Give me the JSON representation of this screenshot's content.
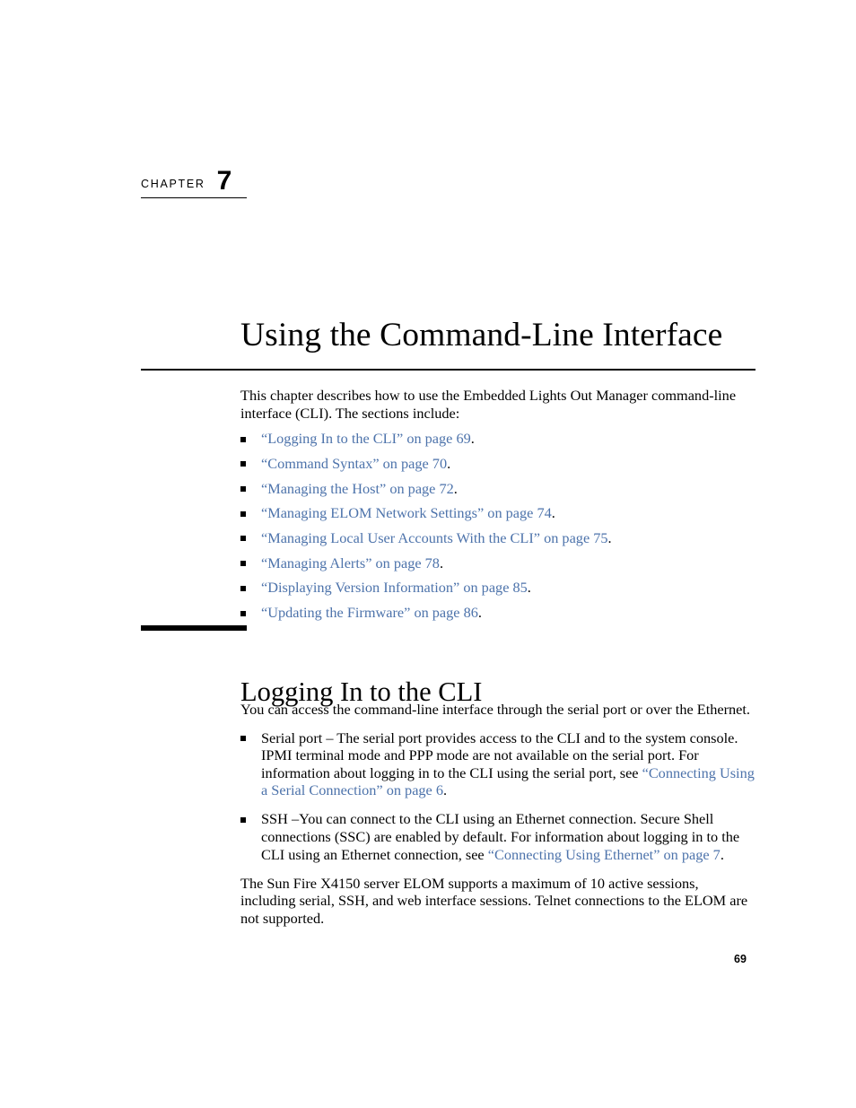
{
  "chapter": {
    "label": "CHAPTER",
    "number": "7",
    "title": "Using the Command-Line Interface"
  },
  "intro": {
    "paragraph": "This chapter describes how to use the Embedded Lights Out Manager command-line interface (CLI). The sections include:"
  },
  "toc": {
    "items": [
      {
        "link": "“Logging In to the CLI” on page 69",
        "trailing": "."
      },
      {
        "link": "“Command Syntax” on page 70",
        "trailing": "."
      },
      {
        "link": "“Managing the Host” on page 72",
        "trailing": "."
      },
      {
        "link": "“Managing ELOM Network Settings” on page 74",
        "trailing": "."
      },
      {
        "link": "“Managing Local User Accounts With the CLI” on page 75",
        "trailing": "."
      },
      {
        "link": "“Managing Alerts” on page 78",
        "trailing": "."
      },
      {
        "link": "“Displaying Version Information” on page 85",
        "trailing": "."
      },
      {
        "link": "“Updating the Firmware” on page 86",
        "trailing": "."
      }
    ]
  },
  "section": {
    "heading": "Logging In to the CLI",
    "intro": "You can access the command-line interface through the serial port or over the Ethernet.",
    "bullets": [
      {
        "text_before": "Serial port – The serial port provides access to the CLI and to the system console. IPMI terminal mode and PPP mode are not available on the serial port. For information about logging in to the CLI using the serial port, see ",
        "link": "“Connecting Using a Serial Connection” on page 6",
        "text_after": "."
      },
      {
        "text_before": "SSH –You can connect to the CLI using an Ethernet connection. Secure Shell connections (SSC) are enabled by default. For information about logging in to the CLI using an Ethernet connection, see ",
        "link": "“Connecting Using Ethernet” on page 7",
        "text_after": "."
      }
    ],
    "closing": "The Sun Fire X4150 server ELOM supports a maximum of 10 active sessions, including serial, SSH, and web interface sessions. Telnet connections to the ELOM are not supported."
  },
  "footer": {
    "page_number": "69"
  },
  "colors": {
    "link": "#4d73ab",
    "text": "#000000",
    "background": "#ffffff"
  }
}
